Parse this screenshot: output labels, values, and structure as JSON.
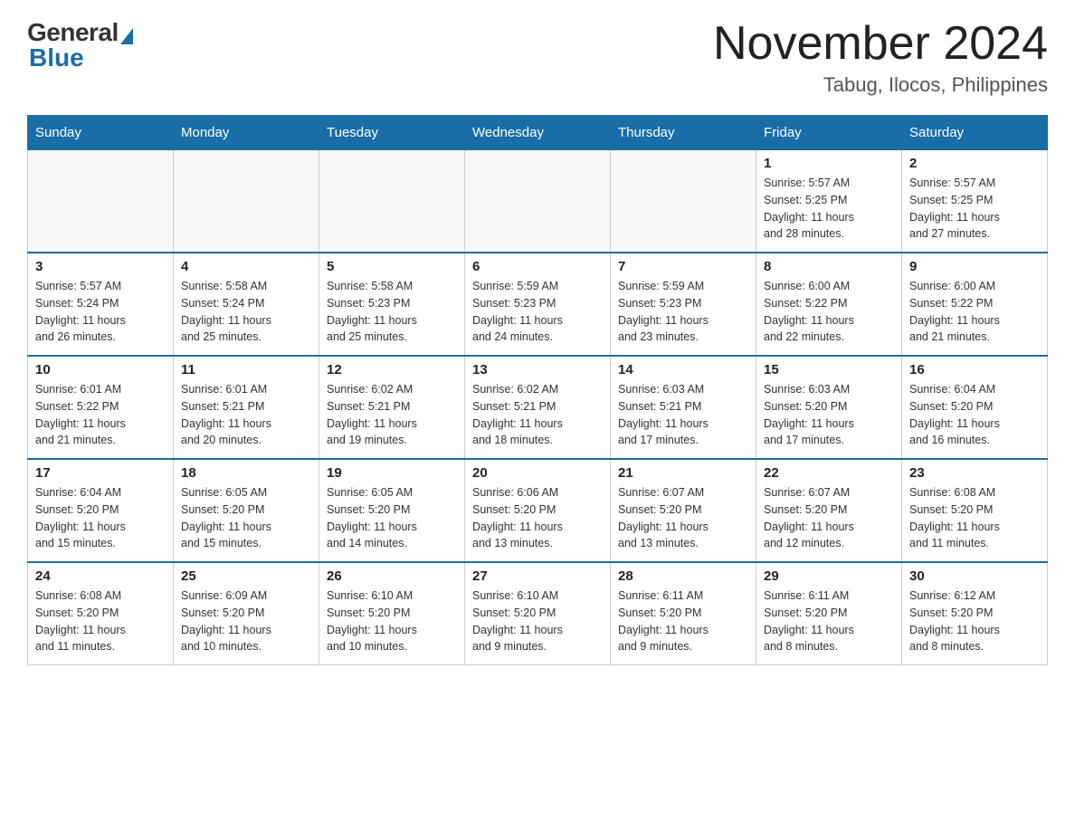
{
  "logo": {
    "general": "General",
    "blue": "Blue"
  },
  "header": {
    "month": "November 2024",
    "location": "Tabug, Ilocos, Philippines"
  },
  "days_of_week": [
    "Sunday",
    "Monday",
    "Tuesday",
    "Wednesday",
    "Thursday",
    "Friday",
    "Saturday"
  ],
  "weeks": [
    [
      {
        "day": "",
        "info": ""
      },
      {
        "day": "",
        "info": ""
      },
      {
        "day": "",
        "info": ""
      },
      {
        "day": "",
        "info": ""
      },
      {
        "day": "",
        "info": ""
      },
      {
        "day": "1",
        "info": "Sunrise: 5:57 AM\nSunset: 5:25 PM\nDaylight: 11 hours\nand 28 minutes."
      },
      {
        "day": "2",
        "info": "Sunrise: 5:57 AM\nSunset: 5:25 PM\nDaylight: 11 hours\nand 27 minutes."
      }
    ],
    [
      {
        "day": "3",
        "info": "Sunrise: 5:57 AM\nSunset: 5:24 PM\nDaylight: 11 hours\nand 26 minutes."
      },
      {
        "day": "4",
        "info": "Sunrise: 5:58 AM\nSunset: 5:24 PM\nDaylight: 11 hours\nand 25 minutes."
      },
      {
        "day": "5",
        "info": "Sunrise: 5:58 AM\nSunset: 5:23 PM\nDaylight: 11 hours\nand 25 minutes."
      },
      {
        "day": "6",
        "info": "Sunrise: 5:59 AM\nSunset: 5:23 PM\nDaylight: 11 hours\nand 24 minutes."
      },
      {
        "day": "7",
        "info": "Sunrise: 5:59 AM\nSunset: 5:23 PM\nDaylight: 11 hours\nand 23 minutes."
      },
      {
        "day": "8",
        "info": "Sunrise: 6:00 AM\nSunset: 5:22 PM\nDaylight: 11 hours\nand 22 minutes."
      },
      {
        "day": "9",
        "info": "Sunrise: 6:00 AM\nSunset: 5:22 PM\nDaylight: 11 hours\nand 21 minutes."
      }
    ],
    [
      {
        "day": "10",
        "info": "Sunrise: 6:01 AM\nSunset: 5:22 PM\nDaylight: 11 hours\nand 21 minutes."
      },
      {
        "day": "11",
        "info": "Sunrise: 6:01 AM\nSunset: 5:21 PM\nDaylight: 11 hours\nand 20 minutes."
      },
      {
        "day": "12",
        "info": "Sunrise: 6:02 AM\nSunset: 5:21 PM\nDaylight: 11 hours\nand 19 minutes."
      },
      {
        "day": "13",
        "info": "Sunrise: 6:02 AM\nSunset: 5:21 PM\nDaylight: 11 hours\nand 18 minutes."
      },
      {
        "day": "14",
        "info": "Sunrise: 6:03 AM\nSunset: 5:21 PM\nDaylight: 11 hours\nand 17 minutes."
      },
      {
        "day": "15",
        "info": "Sunrise: 6:03 AM\nSunset: 5:20 PM\nDaylight: 11 hours\nand 17 minutes."
      },
      {
        "day": "16",
        "info": "Sunrise: 6:04 AM\nSunset: 5:20 PM\nDaylight: 11 hours\nand 16 minutes."
      }
    ],
    [
      {
        "day": "17",
        "info": "Sunrise: 6:04 AM\nSunset: 5:20 PM\nDaylight: 11 hours\nand 15 minutes."
      },
      {
        "day": "18",
        "info": "Sunrise: 6:05 AM\nSunset: 5:20 PM\nDaylight: 11 hours\nand 15 minutes."
      },
      {
        "day": "19",
        "info": "Sunrise: 6:05 AM\nSunset: 5:20 PM\nDaylight: 11 hours\nand 14 minutes."
      },
      {
        "day": "20",
        "info": "Sunrise: 6:06 AM\nSunset: 5:20 PM\nDaylight: 11 hours\nand 13 minutes."
      },
      {
        "day": "21",
        "info": "Sunrise: 6:07 AM\nSunset: 5:20 PM\nDaylight: 11 hours\nand 13 minutes."
      },
      {
        "day": "22",
        "info": "Sunrise: 6:07 AM\nSunset: 5:20 PM\nDaylight: 11 hours\nand 12 minutes."
      },
      {
        "day": "23",
        "info": "Sunrise: 6:08 AM\nSunset: 5:20 PM\nDaylight: 11 hours\nand 11 minutes."
      }
    ],
    [
      {
        "day": "24",
        "info": "Sunrise: 6:08 AM\nSunset: 5:20 PM\nDaylight: 11 hours\nand 11 minutes."
      },
      {
        "day": "25",
        "info": "Sunrise: 6:09 AM\nSunset: 5:20 PM\nDaylight: 11 hours\nand 10 minutes."
      },
      {
        "day": "26",
        "info": "Sunrise: 6:10 AM\nSunset: 5:20 PM\nDaylight: 11 hours\nand 10 minutes."
      },
      {
        "day": "27",
        "info": "Sunrise: 6:10 AM\nSunset: 5:20 PM\nDaylight: 11 hours\nand 9 minutes."
      },
      {
        "day": "28",
        "info": "Sunrise: 6:11 AM\nSunset: 5:20 PM\nDaylight: 11 hours\nand 9 minutes."
      },
      {
        "day": "29",
        "info": "Sunrise: 6:11 AM\nSunset: 5:20 PM\nDaylight: 11 hours\nand 8 minutes."
      },
      {
        "day": "30",
        "info": "Sunrise: 6:12 AM\nSunset: 5:20 PM\nDaylight: 11 hours\nand 8 minutes."
      }
    ]
  ]
}
